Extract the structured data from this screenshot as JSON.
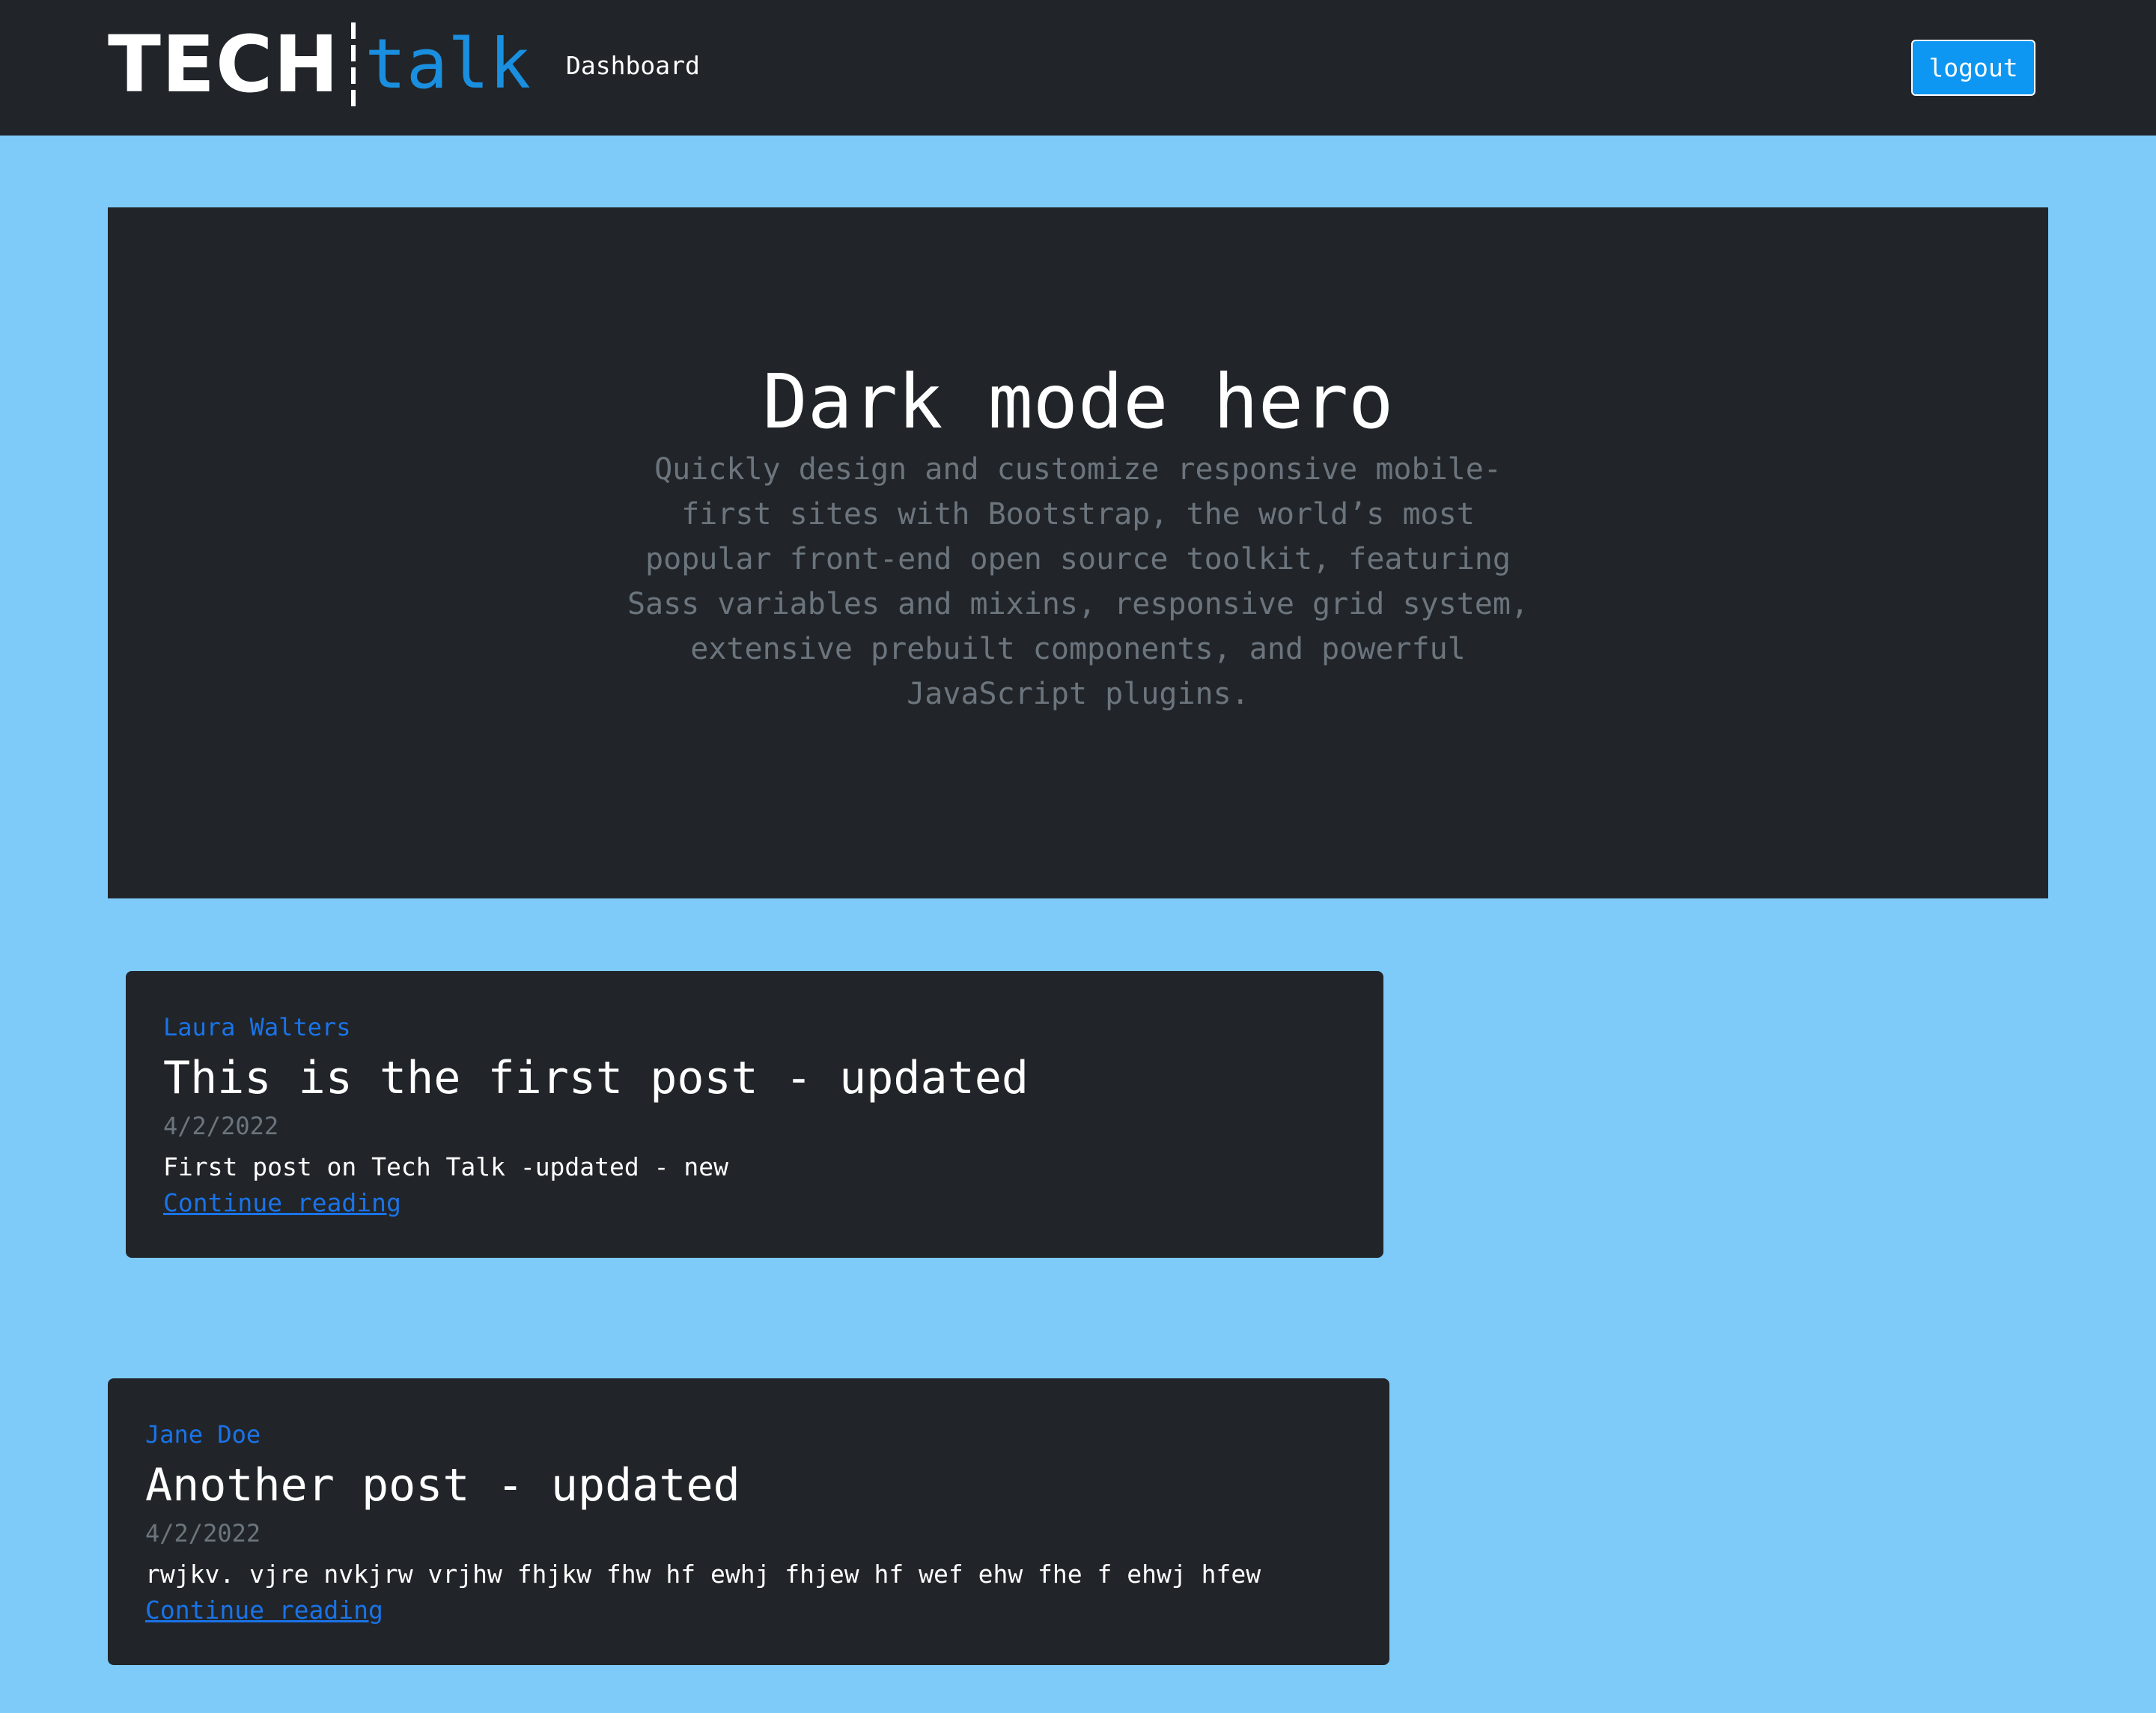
{
  "navbar": {
    "brand_tech": "TECH",
    "brand_talk": "talk",
    "nav_dashboard": "Dashboard",
    "logout_label": "logout"
  },
  "hero": {
    "title": "Dark mode hero",
    "lead": "Quickly design and customize responsive mobile-first sites with Bootstrap, the world’s most popular front-end open source toolkit, featuring Sass variables and mixins, responsive grid system, extensive prebuilt components, and powerful JavaScript plugins."
  },
  "posts": [
    {
      "author": "Laura Walters",
      "title": "This is the first post - updated",
      "date": "4/2/2022",
      "excerpt": "First post on Tech Talk -updated - new",
      "link_label": "Continue reading"
    },
    {
      "author": "Jane Doe",
      "title": "Another post - updated",
      "date": "4/2/2022",
      "excerpt": "rwjkv. vjre nvkjrw vrjhw fhjkw fhw hf ewhj fhjew hf wef ehw fhe f ehwj hfew",
      "link_label": "Continue reading"
    }
  ],
  "colors": {
    "page_background": "#7ecbf9",
    "dark_surface": "#212529",
    "brand_accent": "#1a8fe0",
    "button_primary": "#0d96f2",
    "link_blue": "#1a73e8",
    "muted_text": "#6c757d"
  }
}
